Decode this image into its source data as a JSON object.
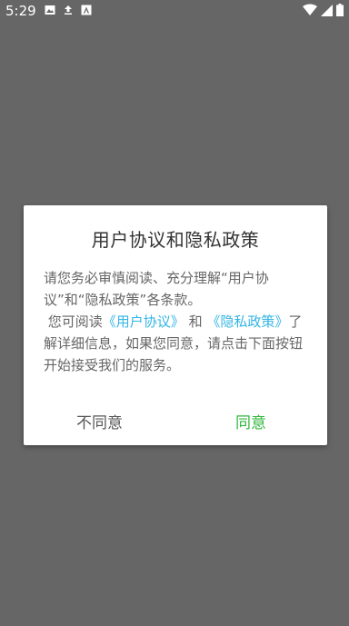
{
  "status_bar": {
    "time": "5:29",
    "icons_left": [
      "image-icon",
      "upload-icon",
      "app-icon"
    ],
    "icons_right": [
      "wifi-icon",
      "signal-icon",
      "battery-icon"
    ]
  },
  "dialog": {
    "title": "用户协议和隐私政策",
    "body": {
      "paragraph1": "请您务必审慎阅读、充分理解“用户协议”和“隐私政策”各条款。",
      "p2_prefix": " 您可阅读",
      "link_user_agreement": "《用户协议》",
      "p2_and": "和",
      "link_privacy_policy": "《隐私政策》",
      "p2_suffix": "了解详细信息，如果您同意，请点击下面按钮开始接受我们的服务。"
    },
    "buttons": {
      "disagree": "不同意",
      "agree": "同意"
    }
  },
  "colors": {
    "overlay": "#666666",
    "link": "#33b5e5",
    "agree": "#2fb73b"
  }
}
